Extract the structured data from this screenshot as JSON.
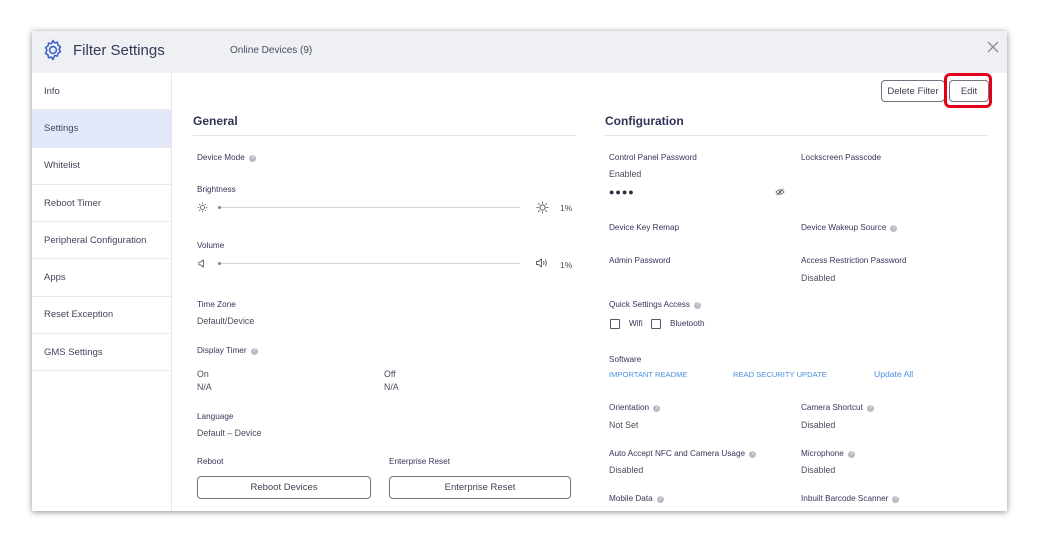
{
  "header": {
    "title": "Filter Settings",
    "online_devices": "Online Devices (9)"
  },
  "sidebar": {
    "items": [
      {
        "label": "Info"
      },
      {
        "label": "Settings"
      },
      {
        "label": "Whitelist"
      },
      {
        "label": "Reboot Timer"
      },
      {
        "label": "Peripheral Configuration"
      },
      {
        "label": "Apps"
      },
      {
        "label": "Reset Exception"
      },
      {
        "label": "GMS Settings"
      }
    ]
  },
  "toolbar": {
    "delete_label": "Delete Filter",
    "edit_label": "Edit"
  },
  "general": {
    "title": "General",
    "device_mode_label": "Device Mode",
    "brightness_label": "Brightness",
    "brightness_value": "1%",
    "volume_label": "Volume",
    "volume_value": "1%",
    "time_zone_label": "Time Zone",
    "time_zone_value": "Default/Device",
    "display_timer_label": "Display Timer",
    "on_label": "On",
    "on_value": "N/A",
    "off_label": "Off",
    "off_value": "N/A",
    "language_label": "Language",
    "language_value": "Default – Device",
    "reboot_label": "Reboot",
    "reboot_button": "Reboot Devices",
    "enterprise_label": "Enterprise Reset",
    "enterprise_button": "Enterprise Reset"
  },
  "configuration": {
    "title": "Configuration",
    "control_panel_label": "Control Panel Password",
    "control_panel_value": "Enabled",
    "control_panel_password": "●●●●",
    "lockscreen_label": "Lockscreen Passcode",
    "key_remap_label": "Device Key Remap",
    "wakeup_label": "Device Wakeup Source",
    "admin_label": "Admin Password",
    "access_label": "Access Restriction Password",
    "access_value": "Disabled",
    "quick_label": "Quick Settings Access",
    "wifi_label": "Wifi",
    "bluetooth_label": "Bluetooth",
    "software_label": "Software",
    "readme_link": "IMPORTANT README",
    "security_link": "READ SECURITY UPDATE",
    "update_all_link": "Update All",
    "orientation_label": "Orientation",
    "orientation_value": "Not Set",
    "camera_shortcut_label": "Camera Shortcut",
    "camera_shortcut_value": "Disabled",
    "nfc_label": "Auto Accept NFC and Camera Usage",
    "nfc_value": "Disabled",
    "microphone_label": "Microphone",
    "microphone_value": "Disabled",
    "mobile_data_label": "Mobile Data",
    "barcode_label": "Inbuilt Barcode Scanner"
  },
  "colors": {
    "accent": "#4a90e2",
    "highlight": "#e3001b",
    "active_sidebar": "#e3e8f8"
  }
}
